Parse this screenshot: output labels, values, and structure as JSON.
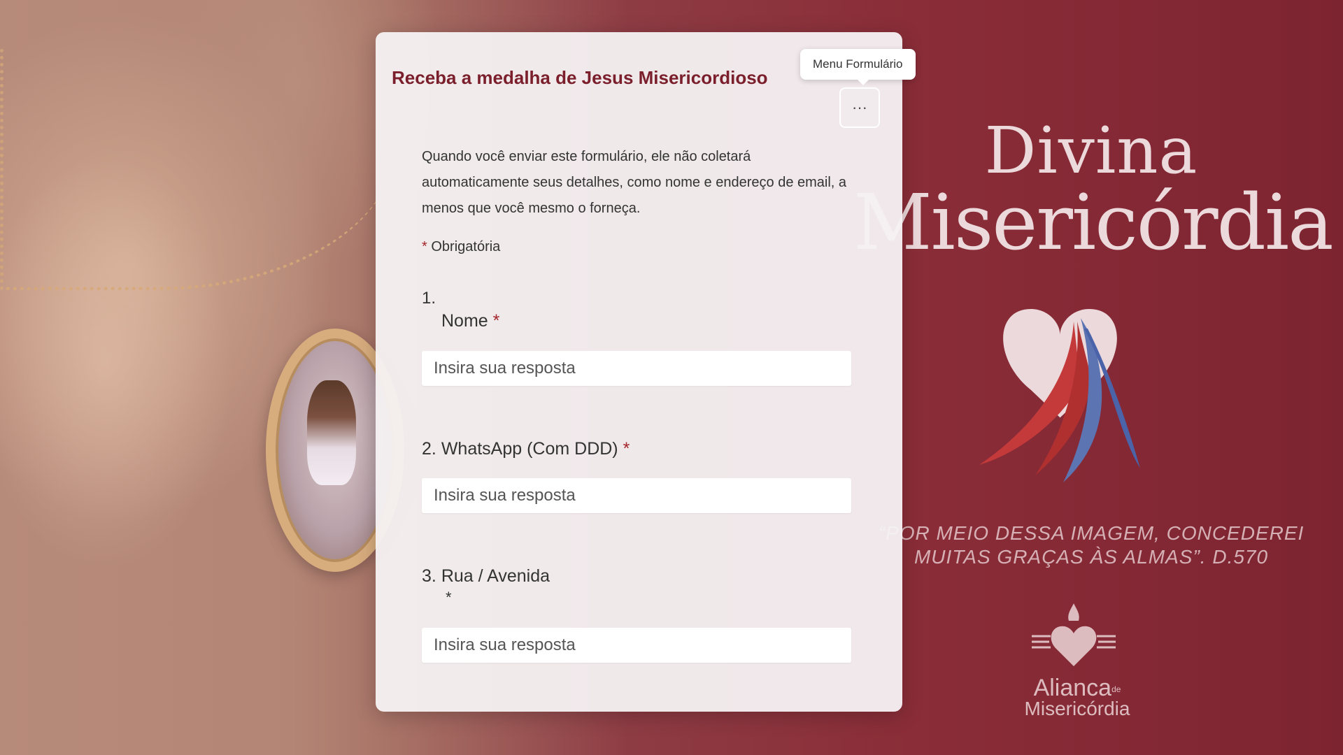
{
  "form": {
    "title": "Receba a medalha de Jesus Misericordioso",
    "menu_button_label": "···",
    "menu_tooltip": "Menu Formulário",
    "notice": "Quando você enviar este formulário, ele não coletará automaticamente seus detalhes, como nome e endereço de email, a menos que você mesmo o forneça.",
    "required_star": "*",
    "required_label": "Obrigatória",
    "questions": [
      {
        "number": "1.",
        "label": "Nome",
        "required_mark": "*",
        "placeholder": "Insira sua resposta"
      },
      {
        "number": "2.",
        "label": "WhatsApp (Com DDD)",
        "required_mark": "*",
        "placeholder": "Insira sua resposta"
      },
      {
        "number": "3.",
        "label": "Rua / Avenida",
        "required_mark": "*",
        "placeholder": "Insira sua resposta"
      }
    ]
  },
  "background": {
    "brand_line1": "Divina",
    "brand_line2": "Misericórdia",
    "quote_line1": "“POR MEIO DESSA IMAGEM, CONCEDEREI",
    "quote_line2": "MUITAS GRAÇAS ÀS ALMAS”. D.570",
    "logo_line1": "Alianca",
    "logo_de": "de",
    "logo_line2": "Misericórdia"
  },
  "colors": {
    "title": "#7a1f2b",
    "required": "#a4262c",
    "background_red": "#8a2d38"
  },
  "icons": {
    "menu": "more-horizontal-icon",
    "heart": "heart-rays-icon",
    "logo": "sacred-heart-icon"
  }
}
